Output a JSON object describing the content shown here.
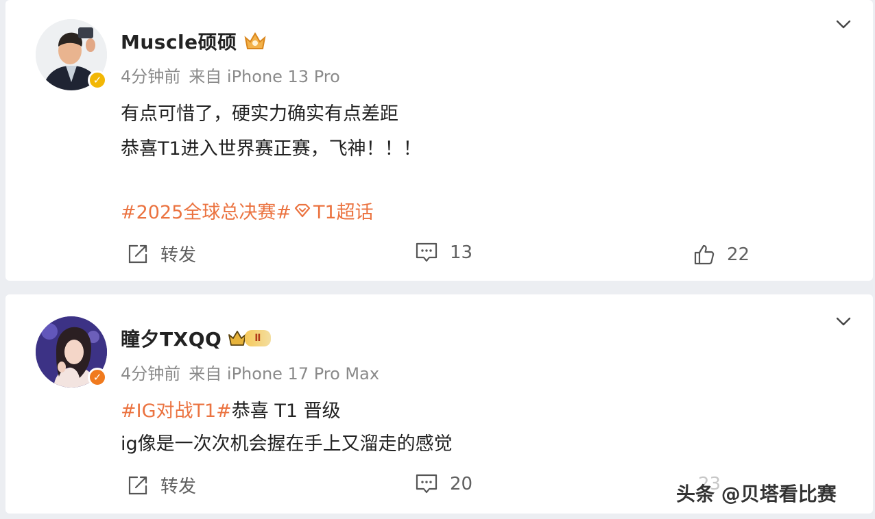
{
  "posts": [
    {
      "username": "Muscle硕硕",
      "time": "4分钟前",
      "source": "来自 iPhone 13 Pro",
      "text_lines": [
        "有点可惜了，硬实力确实有点差距",
        "恭喜T1进入世界赛正赛，飞神！！！"
      ],
      "tags": {
        "part1": "#2025全球总决赛#",
        "part2": "T1超话"
      },
      "actions": {
        "repost_label": "转发",
        "comment_count": "13",
        "like_count": "22"
      },
      "icons": {
        "verified": "verified-badge-icon",
        "rank": "rank-crown-icon",
        "more": "chevron-down-icon"
      }
    },
    {
      "username": "瞳夕TXQQ",
      "time": "4分钟前",
      "source": "来自 iPhone 17 Pro Max",
      "tag_topic": "#IG对战T1#",
      "line1_rest": "恭喜 T1 晋级",
      "line2": "ig像是一次次机会握在手上又溜走的感觉",
      "level_badge": "Ⅱ",
      "actions": {
        "repost_label": "转发",
        "comment_count": "20",
        "like_count": "23"
      },
      "icons": {
        "verified": "verified-badge-icon",
        "rank": "crown-level-icon",
        "more": "chevron-down-icon"
      }
    }
  ],
  "watermark": "头条 @贝塔看比赛",
  "colors": {
    "accent": "#eb7340",
    "verified_gold": "#f2b705",
    "verified_orange": "#f07a1e",
    "muted": "#8a8a8a"
  }
}
